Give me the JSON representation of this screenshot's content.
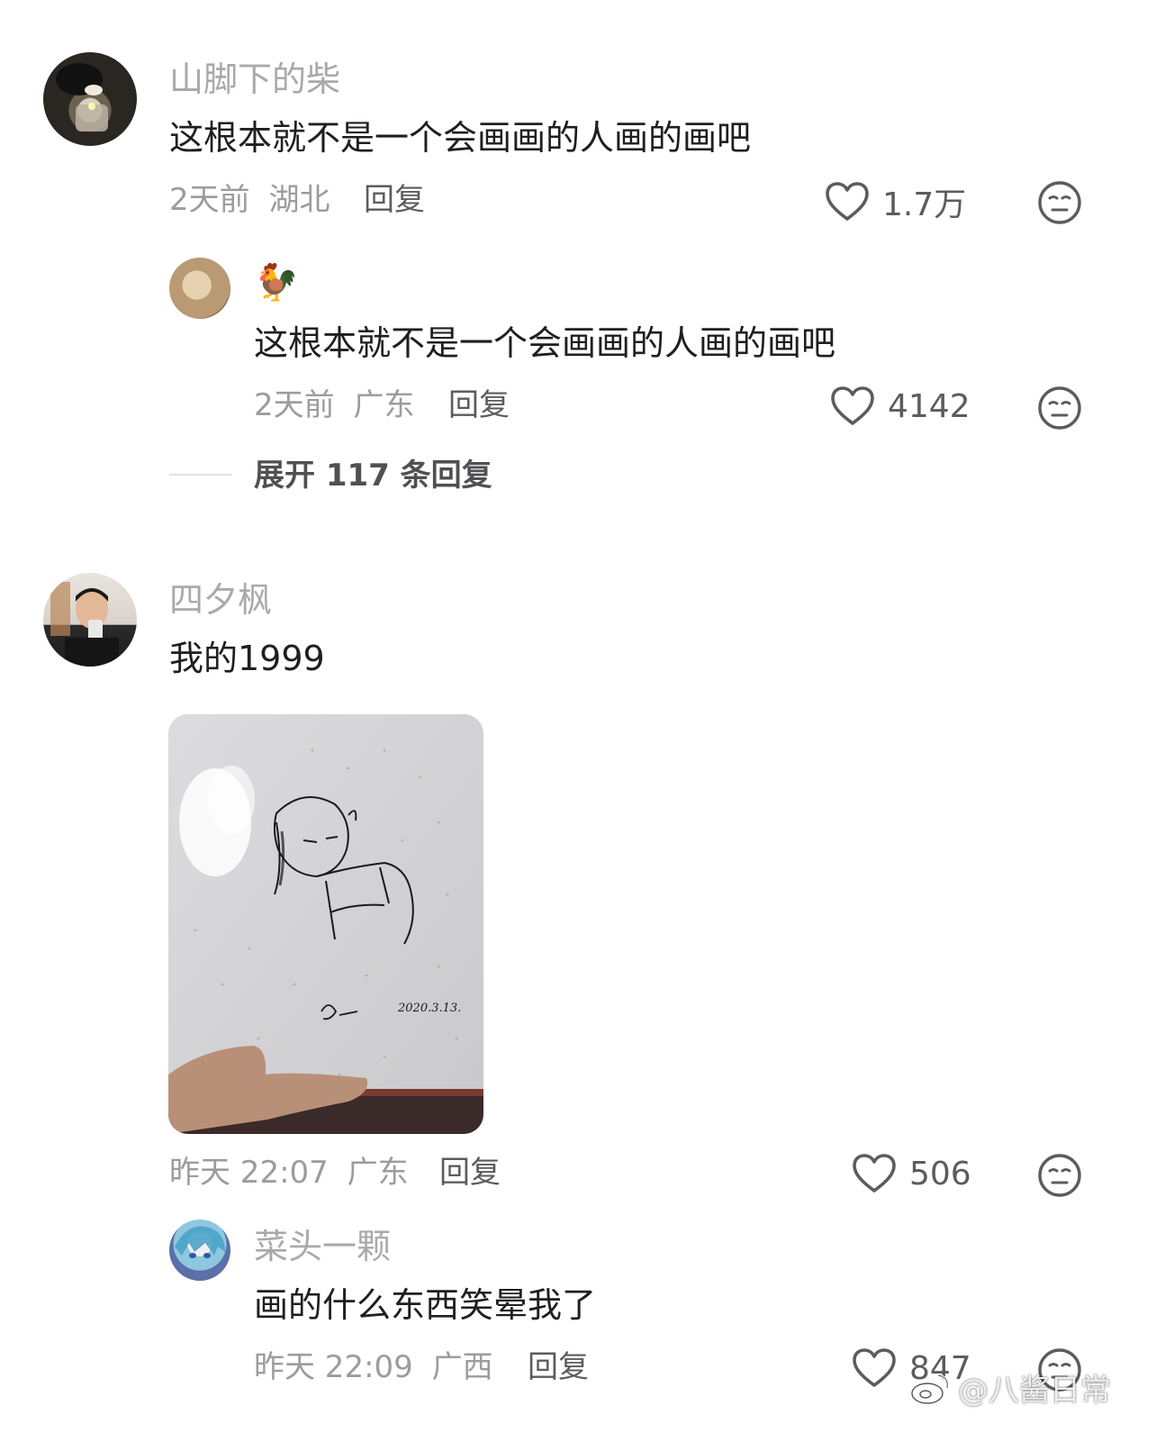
{
  "comments": [
    {
      "username": "山脚下的柴",
      "text": "这根本就不是一个会画画的人画的画吧",
      "time": "2天前",
      "location": "湖北",
      "reply_label": "回复",
      "likes": "1.7万",
      "replies": [
        {
          "username": "🐓",
          "text": "这根本就不是一个会画画的人画的画吧",
          "time": "2天前",
          "location": "广东",
          "reply_label": "回复",
          "likes": "4142"
        }
      ],
      "expand_label": "展开 117 条回复"
    },
    {
      "username": "四夕枫",
      "text": "我的1999",
      "image_signature": "2020.3.13.",
      "time": "昨天 22:07",
      "location": "广东",
      "reply_label": "回复",
      "likes": "506",
      "replies": [
        {
          "username": "菜头一颗",
          "text": "画的什么东西笑晕我了",
          "time": "昨天 22:09",
          "location": "广西",
          "reply_label": "回复",
          "likes": "847"
        }
      ]
    }
  ],
  "watermark": "@八酱日常",
  "icons": {
    "like": "heart-outline-icon",
    "dislike": "neutral-face-icon"
  },
  "colors": {
    "username": "#a9a9ad",
    "text": "#1f1f22",
    "meta": "#9c9ca0",
    "action": "#5c5c60"
  }
}
